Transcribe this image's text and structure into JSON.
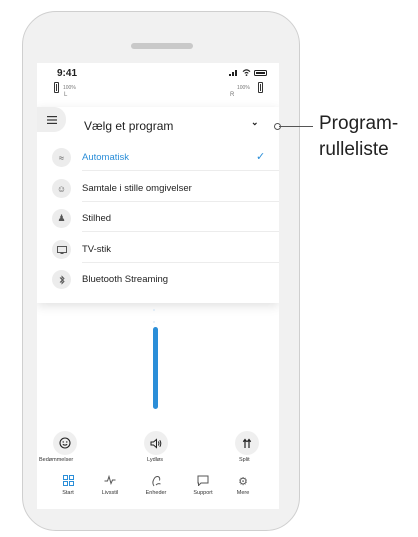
{
  "status_bar": {
    "time": "9:41"
  },
  "hearing_aids": {
    "left": {
      "side": "L",
      "battery": "100%"
    },
    "right": {
      "side": "R",
      "battery": "100%"
    }
  },
  "program_dropdown": {
    "title": "Vælg et program",
    "items": [
      {
        "label": "Automatisk",
        "icon": "automatic-icon",
        "selected": true
      },
      {
        "label": "Samtale i stille omgivelser",
        "icon": "conversation-icon",
        "selected": false
      },
      {
        "label": "Stilhed",
        "icon": "quiet-icon",
        "selected": false
      },
      {
        "label": "TV-stik",
        "icon": "tv-icon",
        "selected": false
      },
      {
        "label": "Bluetooth Streaming",
        "icon": "bluetooth-icon",
        "selected": false
      }
    ]
  },
  "volume": {
    "level": 0.82
  },
  "quick_actions": [
    {
      "label": "Bedømmelser",
      "icon": "smiley-icon"
    },
    {
      "label": "Lydløs",
      "icon": "speaker-icon"
    },
    {
      "label": "Split",
      "icon": "split-icon"
    }
  ],
  "tab_bar": [
    {
      "label": "Start",
      "icon": "grid-icon",
      "active": true
    },
    {
      "label": "Livsstil",
      "icon": "pulse-icon",
      "active": false
    },
    {
      "label": "Enheder",
      "icon": "hearing-aid-icon",
      "active": false
    },
    {
      "label": "Support",
      "icon": "chat-icon",
      "active": false
    },
    {
      "label": "Mere",
      "icon": "gear-icon",
      "active": false
    }
  ],
  "callout": {
    "line1": "Program-",
    "line2": "rulleliste"
  },
  "colors": {
    "accent": "#2b8ed8",
    "phone_frame": "#f1f1f1"
  }
}
